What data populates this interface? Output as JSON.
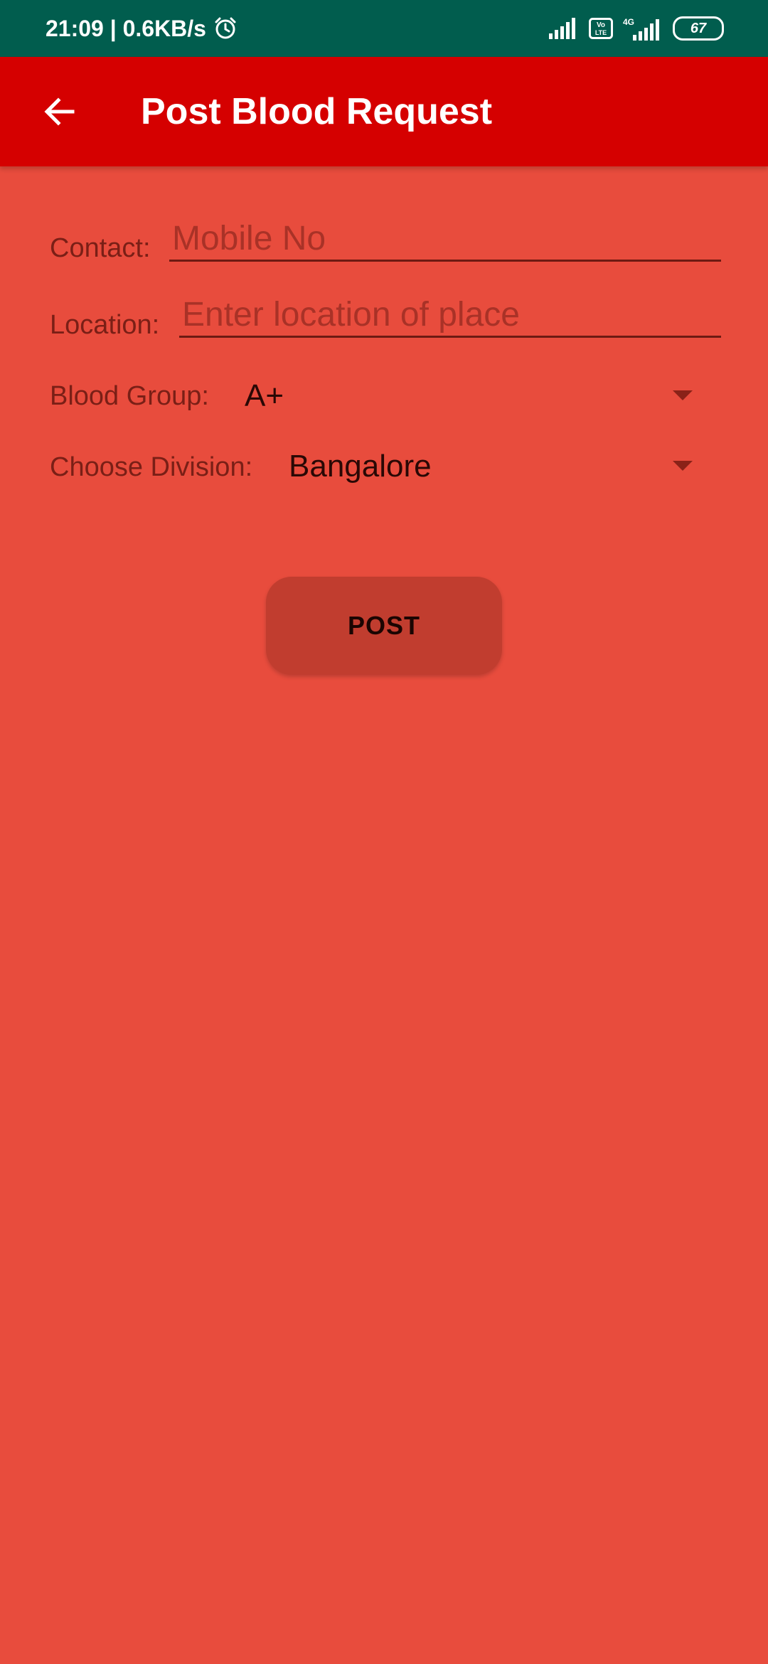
{
  "status_bar": {
    "time_speed": "21:09 | 0.6KB/s",
    "icons": [
      "alarm-icon",
      "signal-icon",
      "volte-icon",
      "4g-signal-icon",
      "battery-icon"
    ],
    "volte_label": "Vo LTE",
    "network_label": "4G",
    "battery_level": "67"
  },
  "app_bar": {
    "back_icon": "arrow-left-icon",
    "title": "Post Blood Request"
  },
  "form": {
    "contact_label": "Contact:",
    "contact_placeholder": "Mobile No",
    "contact_value": "",
    "location_label": "Location:",
    "location_placeholder": "Enter location of place",
    "location_value": "",
    "blood_group_label": "Blood Group:",
    "blood_group_value": "A+",
    "division_label": "Choose Division:",
    "division_value": "Bangalore"
  },
  "post_button_label": "POST",
  "colors": {
    "status_bar": "#015d4e",
    "app_bar": "#d50000",
    "background": "#e84c3d",
    "button": "#c13d2f"
  }
}
